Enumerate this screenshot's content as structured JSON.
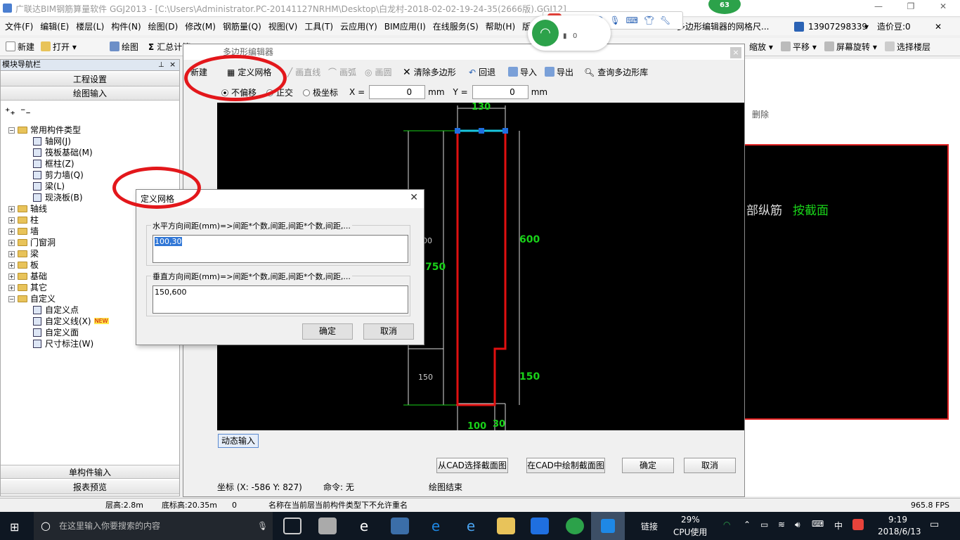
{
  "window": {
    "title": "广联达BIM钢筋算量软件 GGJ2013 - [C:\\Users\\Administrator.PC-20141127NRHM\\Desktop\\白龙村-2018-02-02-19-24-35(2666版).GGJ12]"
  },
  "menu": [
    "文件(F)",
    "编辑(E)",
    "楼层(L)",
    "构件(N)",
    "绘图(D)",
    "修改(M)",
    "钢筋量(Q)",
    "视图(V)",
    "工具(T)",
    "云应用(Y)",
    "BIM应用(I)",
    "在线服务(S)",
    "帮助(H)",
    "版本"
  ],
  "menu_right": {
    "hint": "多边形编辑器的网格尺...",
    "user": "13907298339",
    "price": "造价豆:0"
  },
  "toolbar": {
    "new": "新建",
    "open": "打开",
    "draw": "绘图",
    "sum": "汇总计算",
    "zoom": "缩放",
    "pan": "平移",
    "rotate": "屏幕旋转",
    "select_floor": "选择楼层"
  },
  "nav": {
    "title": "模块导航栏",
    "btn_project": "工程设置",
    "btn_draw": "绘图输入",
    "btn_single": "单构件输入",
    "btn_report": "报表预览",
    "tree": [
      {
        "label": "常用构件类型",
        "level": 0,
        "type": "folder",
        "open": true
      },
      {
        "label": "轴网(J)",
        "level": 1,
        "type": "leaf"
      },
      {
        "label": "筏板基础(M)",
        "level": 1,
        "type": "leaf"
      },
      {
        "label": "框柱(Z)",
        "level": 1,
        "type": "leaf"
      },
      {
        "label": "剪力墙(Q)",
        "level": 1,
        "type": "leaf"
      },
      {
        "label": "梁(L)",
        "level": 1,
        "type": "leaf"
      },
      {
        "label": "现浇板(B)",
        "level": 1,
        "type": "leaf"
      },
      {
        "label": "轴线",
        "level": 0,
        "type": "folder"
      },
      {
        "label": "柱",
        "level": 0,
        "type": "folder"
      },
      {
        "label": "墙",
        "level": 0,
        "type": "folder"
      },
      {
        "label": "门窗洞",
        "level": 0,
        "type": "folder"
      },
      {
        "label": "梁",
        "level": 0,
        "type": "folder"
      },
      {
        "label": "板",
        "level": 0,
        "type": "folder"
      },
      {
        "label": "基础",
        "level": 0,
        "type": "folder"
      },
      {
        "label": "其它",
        "level": 0,
        "type": "folder"
      },
      {
        "label": "自定义",
        "level": 0,
        "type": "folder",
        "open": true
      },
      {
        "label": "自定义点",
        "level": 1,
        "type": "leaf"
      },
      {
        "label": "自定义线(X)",
        "level": 1,
        "type": "leaf",
        "badge": "NEW"
      },
      {
        "label": "自定义面",
        "level": 1,
        "type": "leaf"
      },
      {
        "label": "尺寸标注(W)",
        "level": 1,
        "type": "leaf"
      }
    ]
  },
  "editor": {
    "title": "多边形编辑器",
    "tools": {
      "new": "新建",
      "define_grid": "定义网格",
      "line": "画直线",
      "arc": "画弧",
      "circle": "画圆",
      "clear": "清除多边形",
      "undo": "回退",
      "import": "导入",
      "export": "导出",
      "query": "查询多边形库"
    },
    "options": {
      "no_offset": "不偏移",
      "ortho": "正交",
      "polar": "极坐标",
      "x_label": "X =",
      "x_value": "0",
      "y_label": "Y =",
      "y_value": "0",
      "unit": "mm"
    },
    "dims": {
      "top": "130",
      "right_upper": "600",
      "left_total": "750",
      "left_upper_partial": "00",
      "right_lower": "150",
      "left_lower": "150",
      "bottom_a": "100",
      "bottom_b": "30"
    },
    "dynamic_input": "动态输入",
    "btn_cad_select": "从CAD选择截面图",
    "btn_cad_draw": "在CAD中绘制截面图",
    "btn_ok": "确定",
    "btn_cancel": "取消",
    "status_coord": "坐标 (X: -586 Y: 827)",
    "status_cmd": "命令: 无",
    "status_msg": "绘图结束"
  },
  "background_panel": {
    "delete": "删除",
    "text_a": "部纵筋",
    "text_b": "按截面"
  },
  "dialog": {
    "title": "定义网格",
    "h_label": "水平方向间距(mm)=>间距*个数,间距,间距*个数,间距,...",
    "h_value": "100,30",
    "v_label": "垂直方向间距(mm)=>间距*个数,间距,间距*个数,间距,...",
    "v_value": "150,600",
    "ok": "确定",
    "cancel": "取消"
  },
  "statusbar": {
    "floor_height": "层高:2.8m",
    "bottom_height": "底标高:20.35m",
    "zero": "0",
    "message": "名称在当前层当前构件类型下不允许重名",
    "fps": "965.8 FPS"
  },
  "taskbar": {
    "search_placeholder": "在这里输入你要搜索的内容",
    "link": "链接",
    "cpu_percent": "29%",
    "cpu_label": "CPU使用",
    "ime": "中",
    "time": "9:19",
    "date": "2018/6/13"
  },
  "popups": {
    "badge": "63",
    "net_value": "0"
  },
  "colors": {
    "dim_green": "#19d219",
    "outline_red": "#e01010",
    "grip_blue": "#1f6fe0",
    "annot_red": "#e3171b"
  }
}
